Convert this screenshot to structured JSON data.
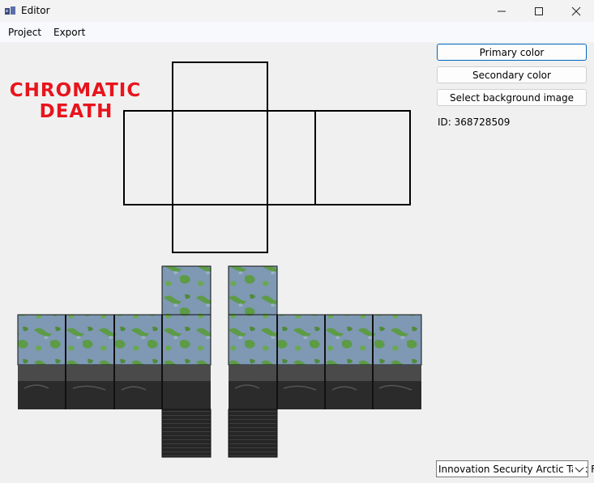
{
  "window": {
    "title": "Editor",
    "icon": "app-icon",
    "controls": [
      "minimize-icon",
      "maximize-icon",
      "close-icon"
    ]
  },
  "menu": {
    "items": [
      "Project",
      "Export"
    ]
  },
  "logo": {
    "text_line1": "CHROMATIC",
    "text_line2": "DEATH",
    "color": "#e8141c"
  },
  "side": {
    "primary_label": "Primary color",
    "secondary_label": "Secondary color",
    "bg_label": "Select background image",
    "id_text": "ID: 368728509"
  },
  "preset": {
    "selected": "Innovation Security Arctic Task For"
  },
  "colors": {
    "accent": "#0067c0",
    "camo_blue": "#7993ad",
    "camo_green": "#5a9a45",
    "dark": "#2a2a2a"
  }
}
